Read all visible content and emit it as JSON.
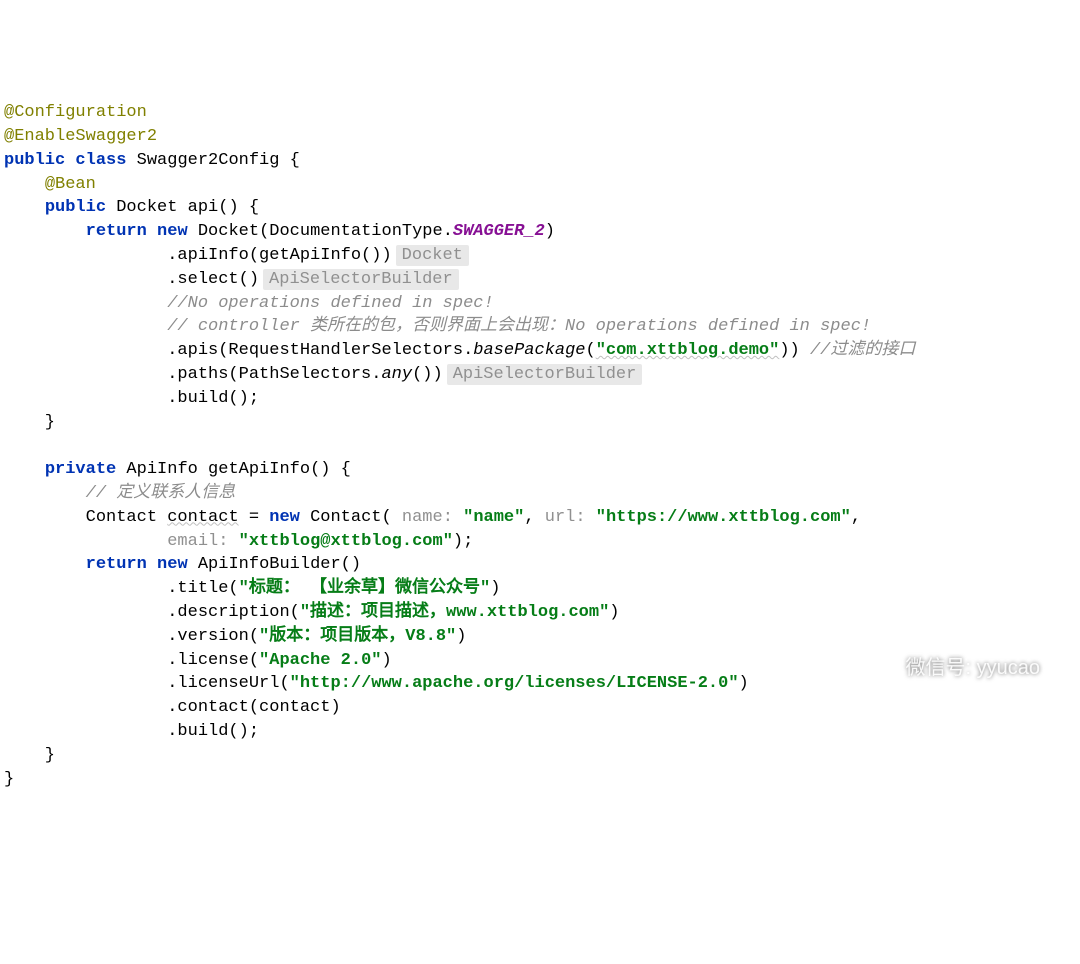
{
  "annotations": {
    "config": "@Configuration",
    "enableSwagger": "@EnableSwagger2",
    "bean": "@Bean"
  },
  "keywords": {
    "public": "public",
    "class": "class",
    "return": "return",
    "new": "new",
    "private": "private"
  },
  "classDecl": {
    "name": "Swagger2Config",
    "brace": " {"
  },
  "apiMethod": {
    "signature1": " Docket api() {",
    "returnNew": " Docket(DocumentationType.",
    "swaggerConst": "SWAGGER_2",
    "close1": ")",
    "apiInfoCall": "                .apiInfo(getApiInfo())",
    "hintDocket": "Docket",
    "selectCall": "                .select()",
    "hintApiSel1": "ApiSelectorBuilder",
    "comment1": "                //No operations defined in spec!",
    "comment2": "                // controller 类所在的包，否则界面上会出现：No operations defined in spec!",
    "apisCall1": "                .apis(RequestHandlerSelectors.",
    "basePackage": "basePackage",
    "apisCall2": "(",
    "basePackageStr": "\"com.xttblog.demo\"",
    "apisCall3": ")) ",
    "comment3": "//过滤的接口",
    "pathsCall1": "                .paths(PathSelectors.",
    "any": "any",
    "pathsCall2": "())",
    "hintApiSel2": "ApiSelectorBuilder",
    "buildCall": "                .build();",
    "closeBrace": "    }"
  },
  "getApiInfo": {
    "signature": " ApiInfo getApiInfo() {",
    "comment": "        // 定义联系人信息",
    "contactDecl1": "        Contact ",
    "contactVar": "contact",
    "contactDecl2": " = ",
    "contactDecl3": " Contact( ",
    "paramName": "name: ",
    "nameStr": "\"name\"",
    "sep1": ", ",
    "paramUrl": "url: ",
    "urlStr": "\"https://www.xttblog.com\"",
    "sep2": ",",
    "line2Indent": "                ",
    "paramEmail": "email: ",
    "emailStr": "\"xttblog@xttblog.com\"",
    "contactClose": ");",
    "returnBuilder": " ApiInfoBuilder()",
    "titleCall1": "                .title(",
    "titleStr": "\"标题： 【业余草】微信公众号\"",
    "titleCall2": ")",
    "descCall1": "                .description(",
    "descStr": "\"描述：项目描述，www.xttblog.com\"",
    "descCall2": ")",
    "versionCall1": "                .version(",
    "versionStr": "\"版本：项目版本，V8.8\"",
    "versionCall2": ")",
    "licenseCall1": "                .license(",
    "licenseStr": "\"Apache 2.0\"",
    "licenseCall2": ")",
    "licenseUrlCall1": "                .licenseUrl(",
    "licenseUrlStr": "\"http://www.apache.org/licenses/LICENSE-2.0\"",
    "licenseUrlCall2": ")",
    "contactCall": "                .contact(contact)",
    "buildCall": "                .build();",
    "closeBrace": "    }"
  },
  "classClose": "}",
  "watermark": {
    "label": "微信号: yyucao"
  }
}
